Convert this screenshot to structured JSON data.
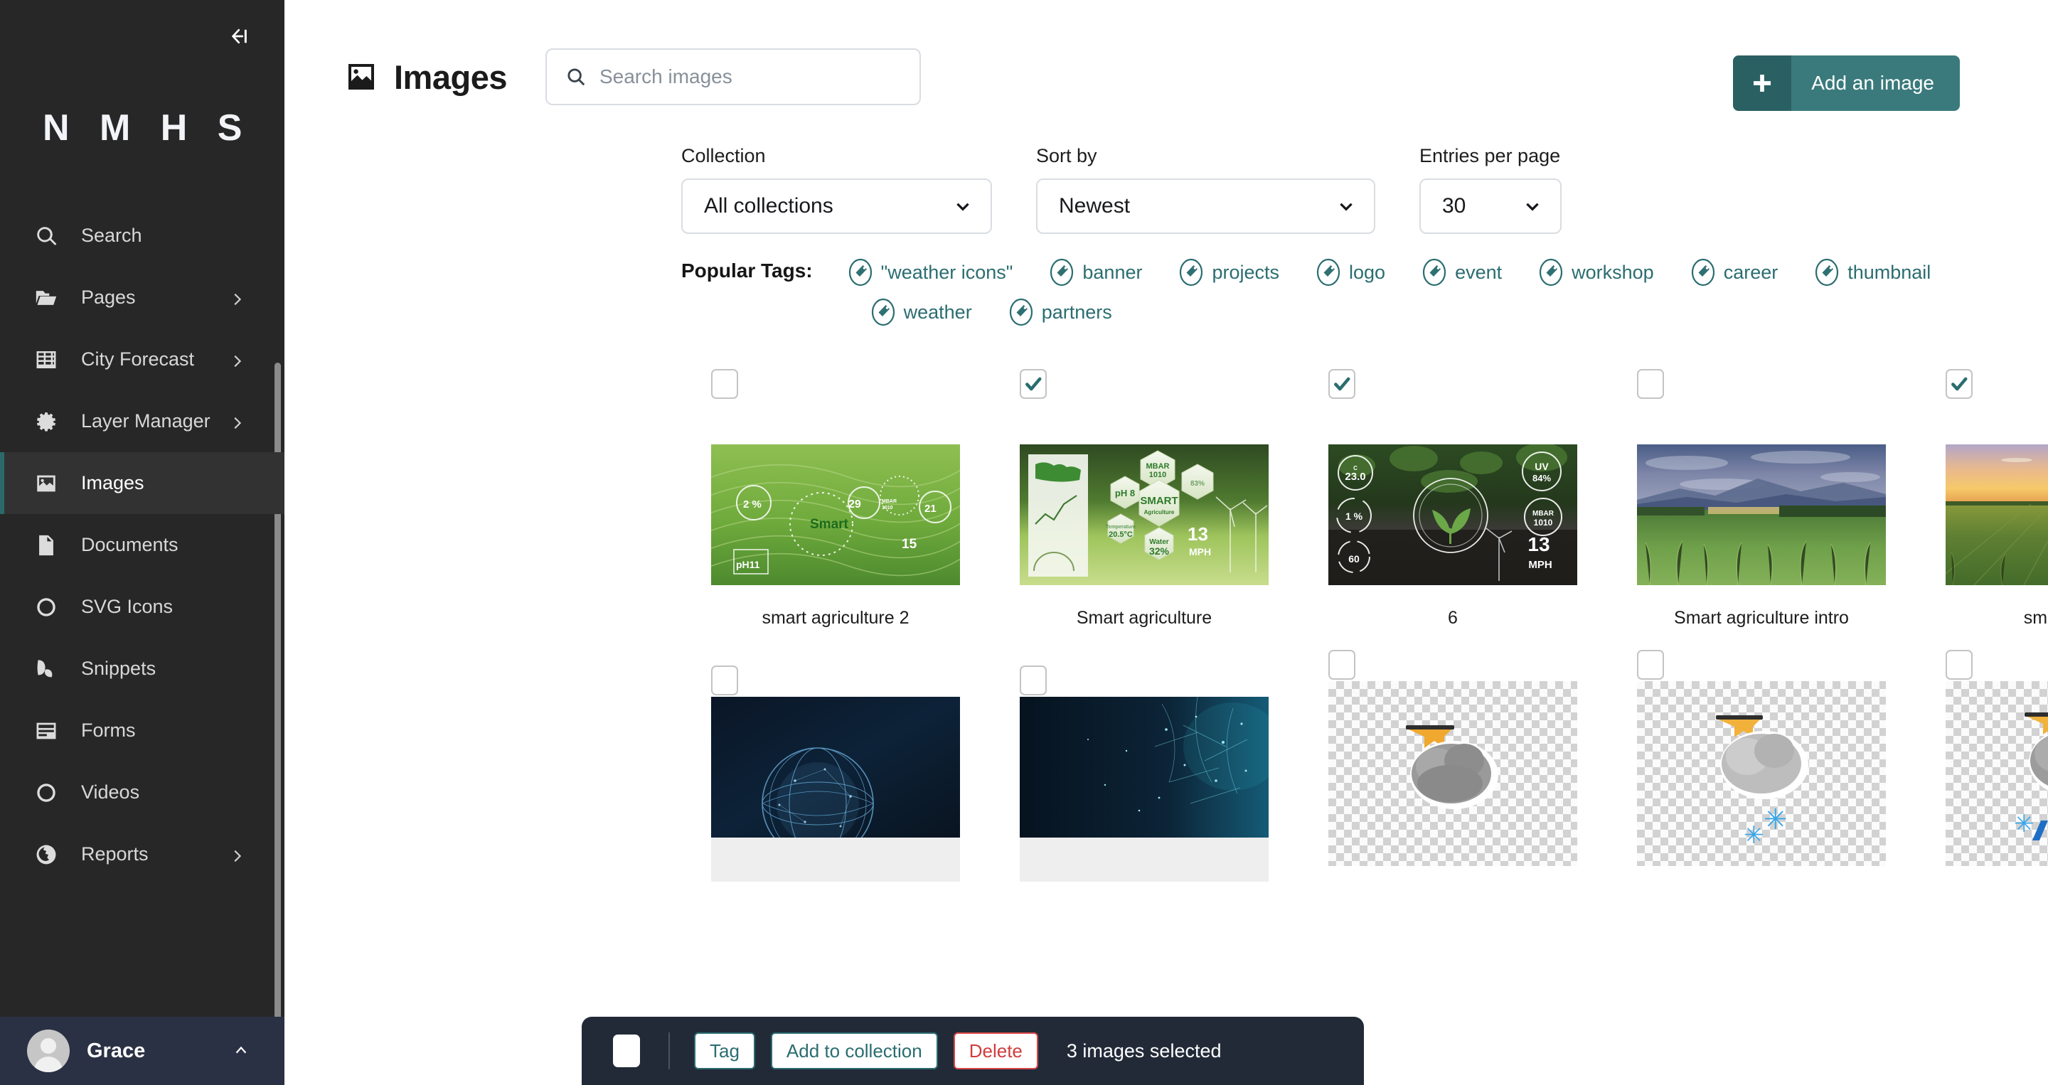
{
  "sidebar": {
    "logo": "N M H S",
    "collapse_icon": "collapse-left-icon",
    "items": [
      {
        "label": "Search",
        "icon": "search-icon",
        "has_children": false,
        "active": false
      },
      {
        "label": "Pages",
        "icon": "folder-icon",
        "has_children": true,
        "active": false
      },
      {
        "label": "City Forecast",
        "icon": "table-icon",
        "has_children": true,
        "active": false
      },
      {
        "label": "Layer Manager",
        "icon": "gear-icon",
        "has_children": true,
        "active": false
      },
      {
        "label": "Images",
        "icon": "image-icon",
        "has_children": false,
        "active": true
      },
      {
        "label": "Documents",
        "icon": "document-icon",
        "has_children": false,
        "active": false
      },
      {
        "label": "SVG Icons",
        "icon": "circle-icon",
        "has_children": false,
        "active": false
      },
      {
        "label": "Snippets",
        "icon": "leaf-icon",
        "has_children": false,
        "active": false
      },
      {
        "label": "Forms",
        "icon": "form-icon",
        "has_children": false,
        "active": false
      },
      {
        "label": "Videos",
        "icon": "circle-icon",
        "has_children": false,
        "active": false
      },
      {
        "label": "Reports",
        "icon": "globe-icon",
        "has_children": true,
        "active": false
      }
    ],
    "user": {
      "name": "Grace",
      "avatar": "user-avatar-icon",
      "chevron": "chevron-up-icon"
    }
  },
  "header": {
    "title": "Images",
    "title_icon": "image-icon",
    "search": {
      "placeholder": "Search images",
      "value": "",
      "icon": "search-icon"
    },
    "add_button": {
      "label": "Add an image",
      "icon": "plus-icon",
      "color": "#3a7a7c"
    }
  },
  "filters": [
    {
      "label": "Collection",
      "value": "All collections"
    },
    {
      "label": "Sort by",
      "value": "Newest"
    },
    {
      "label": "Entries per page",
      "value": "30"
    }
  ],
  "tags": {
    "label": "Popular Tags:",
    "color": "#2b6d70",
    "items": [
      "\"weather icons\"",
      "banner",
      "projects",
      "logo",
      "event",
      "workshop",
      "career",
      "thumbnail",
      "weather",
      "partners"
    ]
  },
  "grid": {
    "row1": [
      {
        "caption": "smart agriculture 2",
        "checked": false,
        "art": "field-contours"
      },
      {
        "caption": "Smart agriculture",
        "checked": true,
        "art": "hexagon-hud"
      },
      {
        "caption": "6",
        "checked": true,
        "art": "seedling-hud"
      },
      {
        "caption": "Smart agriculture intro",
        "checked": false,
        "art": "cornfield-mountains"
      },
      {
        "caption": "smart_agric",
        "checked": true,
        "art": "sunset-field"
      }
    ],
    "row2": [
      {
        "caption": "",
        "checked": false,
        "art": "globe-network"
      },
      {
        "caption": "",
        "checked": false,
        "art": "particle-network"
      },
      {
        "caption": "",
        "checked": false,
        "art": "cloud-sun-icon"
      },
      {
        "caption": "",
        "checked": false,
        "art": "cloud-snow-icon"
      },
      {
        "caption": "",
        "checked": false,
        "art": "cloud-sleet-icon"
      }
    ]
  },
  "action_bar": {
    "select_all_checked": false,
    "tag_label": "Tag",
    "add_to_collection_label": "Add to collection",
    "delete_label": "Delete",
    "status": "3 images selected",
    "accent": "#2b6d70",
    "danger": "#d03d3d"
  }
}
